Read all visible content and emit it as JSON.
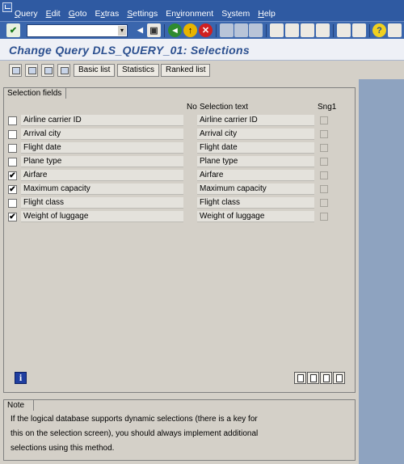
{
  "menu": [
    "Query",
    "Edit",
    "Goto",
    "Extras",
    "Settings",
    "Environment",
    "System",
    "Help"
  ],
  "menu_underline": [
    "Q",
    "E",
    "G",
    "x",
    "S",
    "v",
    "y",
    "H"
  ],
  "command_field": {
    "value": ""
  },
  "title": "Change Query DLS_QUERY_01: Selections",
  "app_toolbar": {
    "basic_list": "Basic list",
    "statistics": "Statistics",
    "ranked_list": "Ranked list"
  },
  "selection_panel": {
    "title": "Selection fields",
    "col_no": "No",
    "col_selection_text": "Selection text",
    "col_sng": "Sng1",
    "rows": [
      {
        "checked": false,
        "field": "Airline carrier ID",
        "text": "Airline carrier ID",
        "no": ""
      },
      {
        "checked": false,
        "field": "Arrival city",
        "text": "Arrival city",
        "no": ""
      },
      {
        "checked": false,
        "field": "Flight date",
        "text": "Flight date",
        "no": ""
      },
      {
        "checked": false,
        "field": "Plane type",
        "text": "Plane type",
        "no": ""
      },
      {
        "checked": true,
        "field": "Airfare",
        "text": "Airfare",
        "no": ""
      },
      {
        "checked": true,
        "field": "Maximum capacity",
        "text": "Maximum capacity",
        "no": ""
      },
      {
        "checked": false,
        "field": "Flight class",
        "text": "Flight class",
        "no": ""
      },
      {
        "checked": true,
        "field": "Weight of luggage",
        "text": "Weight of luggage",
        "no": ""
      }
    ]
  },
  "note": {
    "title": "Note",
    "lines": [
      "If the logical database supports dynamic selections (there is a key for",
      "this on the selection screen), you should always implement additional",
      "selections using this method."
    ]
  },
  "colors": {
    "menubar": "#2f5aa2",
    "toolbar": "#3a66ad",
    "title_text": "#2b4f8f",
    "background": "#d4d0c8"
  },
  "icons": {
    "standard_toolbar": [
      "enter-icon",
      "save-icon",
      "back-icon",
      "exit-icon",
      "cancel-icon",
      "print-icon",
      "find-icon",
      "find-next-icon",
      "first-page-icon",
      "prev-page-icon",
      "next-page-icon",
      "last-page-icon",
      "create-session-icon",
      "shortcut-icon",
      "help-icon",
      "layout-icon"
    ],
    "app_toolbar": [
      "execute-icon",
      "variant-icon",
      "nav-icon",
      "layout-icon"
    ],
    "panel_bottom": [
      "info-icon",
      "first-page-icon",
      "prev-page-icon",
      "next-page-icon",
      "last-page-icon"
    ]
  }
}
